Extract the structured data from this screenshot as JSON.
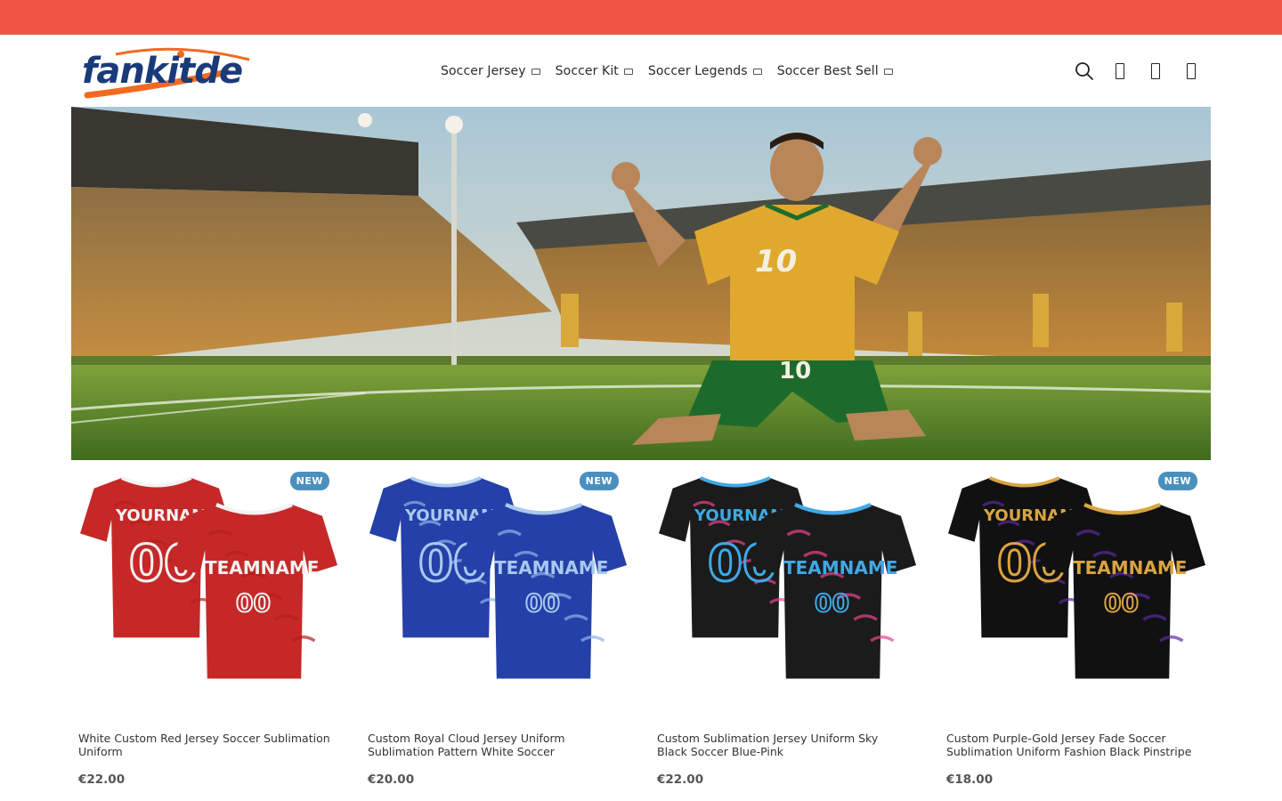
{
  "colors": {
    "promo": "#f15546",
    "badge": "#4b8fbd",
    "brand_blue": "#1a3a7a",
    "brand_orange": "#f26a21"
  },
  "brand": {
    "name": "fankitde"
  },
  "nav": [
    {
      "label": "Soccer Jersey",
      "icon": "chevron-down-icon"
    },
    {
      "label": "Soccer Kit",
      "icon": "chevron-down-icon"
    },
    {
      "label": "Soccer Legends",
      "icon": "chevron-down-icon"
    },
    {
      "label": "Soccer Best Sell",
      "icon": "chevron-down-icon"
    }
  ],
  "actions": [
    {
      "icon": "search-icon"
    },
    {
      "icon": "user-icon"
    },
    {
      "icon": "wishlist-icon"
    },
    {
      "icon": "cart-icon"
    }
  ],
  "hero": {
    "jersey_number": "10",
    "short_number": "10"
  },
  "products": [
    {
      "badge": "NEW",
      "title": "White Custom Red Jersey Soccer Sublimation Uniform",
      "price": "€22.00",
      "name_text": "YOURNAME",
      "team_text": "TEAMNAME",
      "number_text": "00",
      "colors": {
        "body": "#c62828",
        "accent": "#f2f2f2",
        "pattern": "#b71c1c"
      }
    },
    {
      "badge": "NEW",
      "title": "Custom Royal Cloud Jersey Uniform Sublimation Pattern White Soccer",
      "price": "€20.00",
      "name_text": "YOURNAME",
      "team_text": "TEAMNAME",
      "number_text": "00",
      "colors": {
        "body": "#2540a8",
        "accent": "#a9c8f0",
        "pattern": "#8fb2ea"
      }
    },
    {
      "badge": "",
      "title": "Custom Sublimation Jersey Uniform Sky Black Soccer Blue-Pink",
      "price": "€22.00",
      "name_text": "YOURNAME",
      "team_text": "TEAMNAME",
      "number_text": "00",
      "colors": {
        "body": "#1b1b1b",
        "accent": "#3fa9e6",
        "pattern": "#e8438c"
      }
    },
    {
      "badge": "NEW",
      "title": "Custom Purple-Gold Jersey Fade Soccer Sublimation Uniform Fashion Black Pinstripe",
      "price": "€18.00",
      "name_text": "YOURNAME",
      "team_text": "TEAMNAME",
      "number_text": "00",
      "colors": {
        "body": "#111111",
        "accent": "#d9a441",
        "pattern": "#5b2aa0"
      }
    }
  ]
}
